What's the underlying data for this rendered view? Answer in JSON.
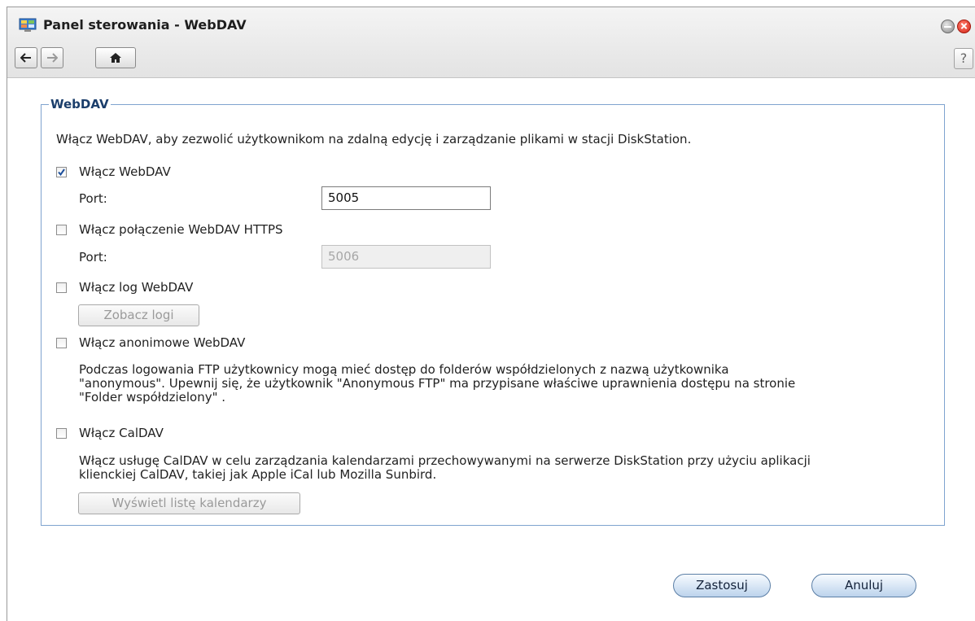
{
  "window": {
    "title": "Panel sterowania - WebDAV",
    "help": "?"
  },
  "section": {
    "legend": "WebDAV",
    "description": "Włącz WebDAV, aby zezwolić użytkownikom na zdalną edycję i zarządzanie plikami w stacji DiskStation."
  },
  "webdav": {
    "label": "Włącz WebDAV",
    "checked": true,
    "port_label": "Port:",
    "port_value": "5005"
  },
  "https": {
    "label": "Włącz połączenie WebDAV HTTPS",
    "checked": false,
    "port_label": "Port:",
    "port_value": "5006"
  },
  "log": {
    "label": "Włącz log WebDAV",
    "checked": false,
    "button": "Zobacz logi"
  },
  "anon": {
    "label": "Włącz anonimowe WebDAV",
    "checked": false,
    "desc_line1": "Podczas logowania FTP użytkownicy mogą mieć dostęp do folderów współdzielonych z nazwą użytkownika",
    "desc_line2": "\"anonymous\". Upewnij się, że użytkownik \"Anonymous FTP\" ma przypisane właściwe uprawnienia dostępu na stronie",
    "desc_line3": "\"Folder współdzielony\" ."
  },
  "caldav": {
    "label": "Włącz CalDAV",
    "checked": false,
    "desc_line1": "Włącz usługę CalDAV w celu zarządzania kalendarzami przechowywanymi na serwerze DiskStation przy użyciu aplikacji",
    "desc_line2": "klienckiej CalDAV, takiej jak Apple iCal lub Mozilla Sunbird.",
    "button": "Wyświetl listę kalendarzy"
  },
  "footer": {
    "apply": "Zastosuj",
    "cancel": "Anuluj"
  },
  "colors": {
    "accent": "#7fa3cf",
    "legend": "#1b3e6b",
    "close": "#d4281a"
  }
}
